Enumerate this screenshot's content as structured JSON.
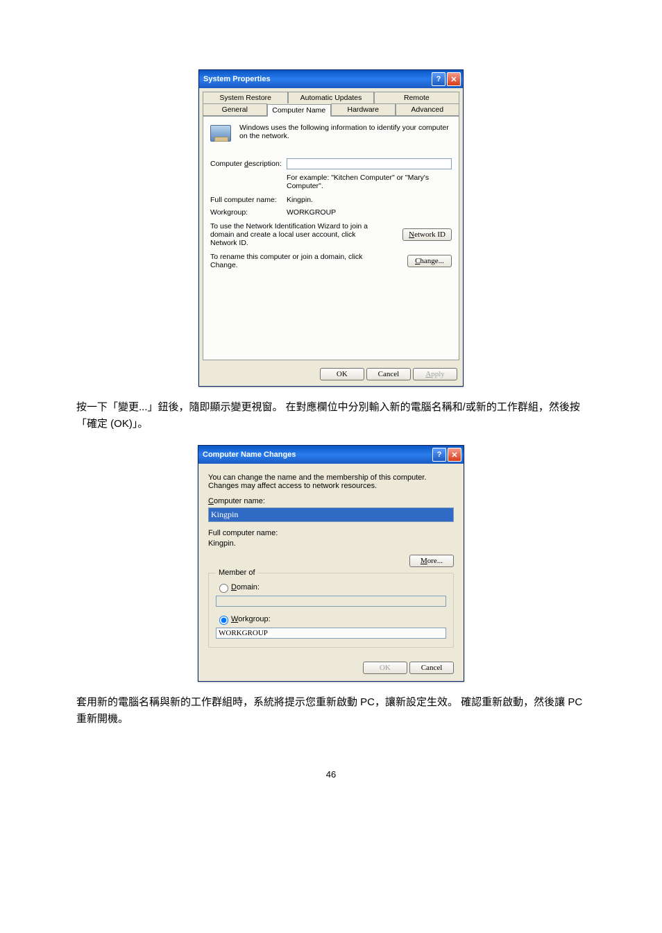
{
  "page_number": "46",
  "paragraph1": "按一下「變更...」鈕後，隨即顯示變更視窗。 在對應欄位中分別輸入新的電腦名稱和/或新的工作群組，然後按「確定 (OK)」。",
  "paragraph2": "套用新的電腦名稱與新的工作群組時，系統將提示您重新啟動 PC，讓新設定生效。 確認重新啟動，然後讓 PC 重新開機。",
  "sysprops": {
    "title": "System Properties",
    "tabs_row1": [
      "System Restore",
      "Automatic Updates",
      "Remote"
    ],
    "tabs_row2": [
      "General",
      "Computer Name",
      "Hardware",
      "Advanced"
    ],
    "info": "Windows uses the following information to identify your computer on the network.",
    "desc_label_prefix_u": "d",
    "desc_label": "Computer description:",
    "desc_value": "",
    "example": "For example: \"Kitchen Computer\" or \"Mary's Computer\".",
    "full_label": "Full computer name:",
    "full_value": "Kingpin.",
    "wg_label": "Workgroup:",
    "wg_value": "WORKGROUP",
    "netid_text": "To use the Network Identification Wizard to join a domain and create a local user account, click Network ID.",
    "netid_btn_u": "N",
    "netid_btn": "etwork ID",
    "change_text": "To rename this computer or join a domain, click Change.",
    "change_btn_u": "C",
    "change_btn": "hange...",
    "ok": "OK",
    "cancel": "Cancel",
    "apply_u": "A",
    "apply": "pply"
  },
  "cnc": {
    "title": "Computer Name Changes",
    "desc": "You can change the name and the membership of this computer. Changes may affect access to network resources.",
    "cn_label_u": "C",
    "cn_label": "omputer name:",
    "cn_value": "Kingpin",
    "full_label": "Full computer name:",
    "full_value": "Kingpin.",
    "more_u": "M",
    "more": "ore...",
    "fieldset": "Member of",
    "domain_u": "D",
    "domain": "omain:",
    "domain_value": "",
    "workgroup_u": "W",
    "workgroup": "orkgroup:",
    "workgroup_value": "WORKGROUP",
    "ok": "OK",
    "cancel": "Cancel"
  }
}
